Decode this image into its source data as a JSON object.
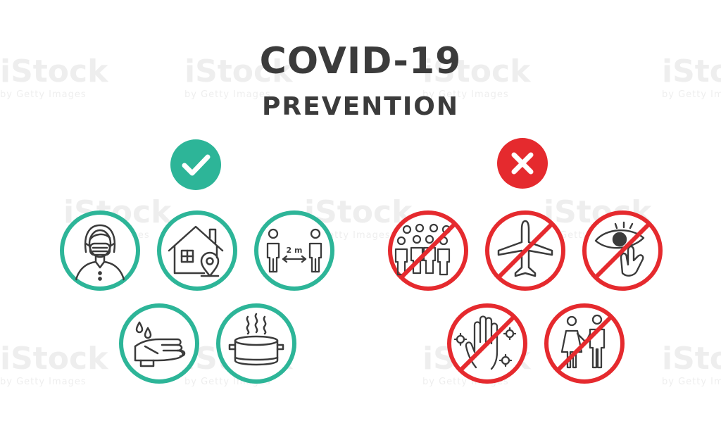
{
  "title": {
    "line1": "COVID-19",
    "line2": "PREVENTION"
  },
  "colors": {
    "do": "#2db598",
    "dont": "#e52a2e",
    "stroke": "#3b3b3b",
    "title": "#3b3b3b"
  },
  "do_section": {
    "badge_icon": "check-icon",
    "icons": [
      {
        "name": "face-mask-person-icon"
      },
      {
        "name": "stay-home-icon"
      },
      {
        "name": "social-distance-icon",
        "label": "2 m"
      },
      {
        "name": "wash-hands-icon"
      },
      {
        "name": "cooking-pot-icon"
      }
    ]
  },
  "dont_section": {
    "badge_icon": "cross-icon",
    "icons": [
      {
        "name": "no-crowd-icon"
      },
      {
        "name": "no-travel-icon"
      },
      {
        "name": "no-touch-eyes-icon"
      },
      {
        "name": "no-touch-virus-hand-icon"
      },
      {
        "name": "no-close-contact-icon"
      }
    ]
  },
  "watermark": {
    "brand": "iStock",
    "sub": "by Getty Images"
  }
}
